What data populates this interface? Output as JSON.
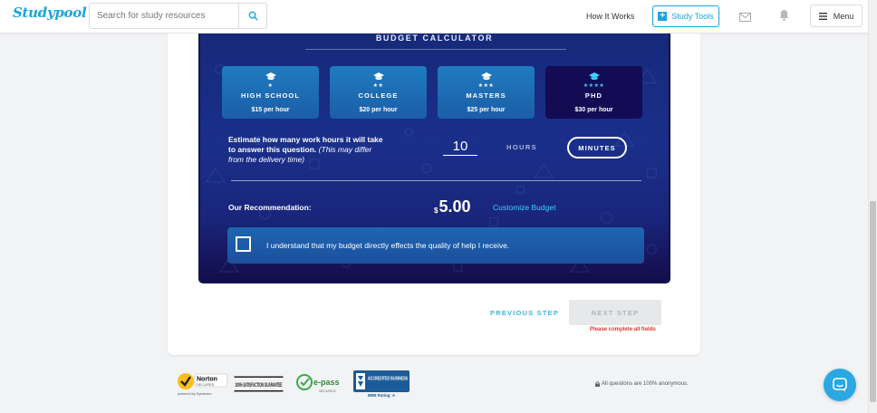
{
  "header": {
    "logo": "Studypool",
    "search_placeholder": "Search for study resources",
    "how_it_works": "How It Works",
    "study_tools": "Study Tools",
    "menu": "Menu"
  },
  "calculator": {
    "title": "BUDGET CALCULATOR",
    "tiers": [
      {
        "name": "HIGH SCHOOL",
        "price": "$15 per hour",
        "stars": "★",
        "selected": false
      },
      {
        "name": "COLLEGE",
        "price": "$20 per hour",
        "stars": "★★",
        "selected": false
      },
      {
        "name": "MASTERS",
        "price": "$25 per hour",
        "stars": "★★★",
        "selected": false
      },
      {
        "name": "PHD",
        "price": "$30 per hour",
        "stars": "★★★★",
        "selected": true
      }
    ],
    "hours_question": "Estimate how many work hours it will take to answer this question.",
    "hours_note": "(This may differ from the delivery time)",
    "hours_value": "10",
    "unit_hours": "HOURS",
    "unit_minutes": "MINUTES",
    "recommendation_label": "Our Recommendation:",
    "currency": "$",
    "recommendation_value": "5.00",
    "customize_link": "Customize Budget",
    "agree_text": "I understand that my budget directly effects the quality of help I receive.",
    "agree_checked": false
  },
  "steps": {
    "previous": "PREVIOUS STEP",
    "next": "NEXT STEP",
    "error": "Please complete all fields"
  },
  "footer": {
    "norton_label": "Norton",
    "norton_sub": "SECURED",
    "norton_by": "powered by Symantec",
    "satisfaction_label": "100% SATISFACTION GUARANTEE",
    "epass_label": "e-pass",
    "epass_sub": "SECURED",
    "bbb_label": "ACCREDITED BUSINESS",
    "bbb_rating": "BBB Rating: A",
    "anonymous_note": "All questions are 100% anonymous."
  },
  "colors": {
    "brand": "#1aa6d9",
    "calc_bg": "#1a2f8a",
    "accent_cyan": "#3fd1ff",
    "error": "#e2342e"
  }
}
